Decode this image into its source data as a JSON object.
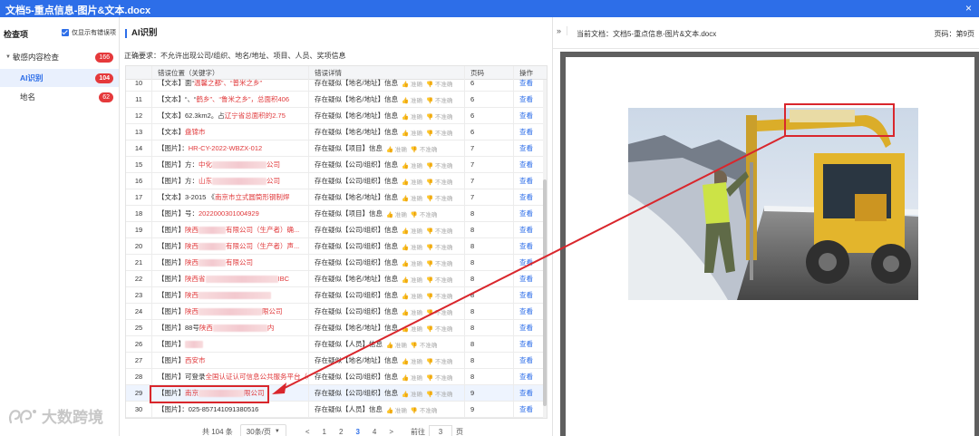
{
  "titlebar": {
    "title": "文档5-重点信息-图片&文本.docx",
    "close": "×"
  },
  "sidebar": {
    "heading": "检查项",
    "only_errors": "仅显示有错误项",
    "items": [
      {
        "label": "敏感内容检查",
        "count": "166"
      },
      {
        "label": "AI识别",
        "count": "104"
      },
      {
        "label": "地名",
        "count": "62"
      }
    ]
  },
  "watermark": "大数跨境",
  "main": {
    "title": "AI识别",
    "requirement": "正确要求：不允许出现公司/组织、地名/地址、项目、人员、奖项信息",
    "columns": [
      "",
      "错误位置（关键字）",
      "错误详情",
      "页码",
      "操作"
    ],
    "accurate_label": "准确",
    "inaccurate_label": "不准确",
    "view_label": "查看",
    "rows": [
      {
        "no": "10",
        "pre": "【文本】面“",
        "red": "温馨之都",
        "post": "”、“普米之乡”",
        "detail": "存在疑似【地名/地址】信息",
        "page": "6"
      },
      {
        "no": "11",
        "pre": "【文本】“、“",
        "red": "鹤乡",
        "post": "”、“鲁米之乡”，总面积406",
        "detail": "存在疑似【地名/地址】信息",
        "page": "6"
      },
      {
        "no": "12",
        "pre": "【文本】62.3km2。占",
        "red": "辽宁省",
        "post": "总面积的2.75",
        "detail": "存在疑似【地名/地址】信息",
        "page": "6"
      },
      {
        "no": "13",
        "pre": "【文本】",
        "red": "盘锦市",
        "post": "",
        "detail": "存在疑似【地名/地址】信息",
        "page": "6"
      },
      {
        "no": "14",
        "pre": "【图片】：",
        "red": "HR-CY-2022-WBZX-012",
        "post": "",
        "detail": "存在疑似【项目】信息",
        "page": "7"
      },
      {
        "no": "15",
        "pre": "【图片】方：",
        "red": "中化",
        "post": "公司",
        "detail": "存在疑似【公司/组织】信息",
        "page": "7",
        "blur": 60
      },
      {
        "no": "16",
        "pre": "【图片】方：",
        "red": "山东",
        "post": "公司",
        "detail": "存在疑似【公司/组织】信息",
        "page": "7",
        "blur": 60
      },
      {
        "no": "17",
        "pre": "【文本】3-2015 《",
        "red": "南京市",
        "post": "立式圆筒形钢制焊",
        "detail": "存在疑似【地名/地址】信息",
        "page": "7"
      },
      {
        "no": "18",
        "pre": "【图片】号：",
        "red": "2022000301004929",
        "post": "",
        "detail": "存在疑似【项目】信息",
        "page": "8"
      },
      {
        "no": "19",
        "pre": "【图片】",
        "red": "陕西",
        "post": "有限公司（生产者）确...",
        "detail": "存在疑似【公司/组织】信息",
        "page": "8",
        "blur": 30
      },
      {
        "no": "20",
        "pre": "【图片】",
        "red": "陕西",
        "post": "有限公司（生产者）声...",
        "detail": "存在疑似【公司/组织】信息",
        "page": "8",
        "blur": 30
      },
      {
        "no": "21",
        "pre": "【图片】",
        "red": "陕西",
        "post": "有限公司",
        "detail": "存在疑似【公司/组织】信息",
        "page": "8",
        "blur": 30
      },
      {
        "no": "22",
        "pre": "【图片】",
        "red": "陕西省",
        "post": "IBC",
        "detail": "存在疑似【地名/地址】信息",
        "page": "8",
        "blur": 80
      },
      {
        "no": "23",
        "pre": "【图片】",
        "red": "陕西",
        "post": "",
        "detail": "存在疑似【公司/组织】信息",
        "page": "8",
        "blur": 80
      },
      {
        "no": "24",
        "pre": "【图片】",
        "red": "陕西",
        "post": "限公司",
        "detail": "存在疑似【公司/组织】信息",
        "page": "8",
        "blur": 70
      },
      {
        "no": "25",
        "pre": "【图片】88号",
        "red": "陕西",
        "post": "内",
        "detail": "存在疑似【地名/地址】信息",
        "page": "8",
        "blur": 60
      },
      {
        "no": "26",
        "pre": "【图片】",
        "red": "",
        "post": "",
        "detail": "存在疑似【人员】信息",
        "page": "8",
        "blur": 20
      },
      {
        "no": "27",
        "pre": "【图片】",
        "red": "西安市",
        "post": "",
        "detail": "存在疑似【地名/地址】信息",
        "page": "8"
      },
      {
        "no": "28",
        "pre": "【图片】可登录",
        "red": "全国认证认可信息公共服务平台",
        "post": "（cx",
        "detail": "存在疑似【公司/组织】信息",
        "page": "8"
      },
      {
        "no": "29",
        "pre": "【图片】",
        "red": "南京",
        "post": "限公司",
        "detail": "存在疑似【公司/组织】信息",
        "page": "9",
        "blur": 50,
        "selected": true
      },
      {
        "no": "30",
        "pre": "【图片】：025-857141091380516",
        "red": "",
        "post": "",
        "detail": "存在疑似【人员】信息",
        "page": "9"
      }
    ]
  },
  "pager": {
    "total": "共 104 条",
    "size": "30条/页",
    "prev": "<",
    "next": ">",
    "pages": [
      "1",
      "2",
      "3",
      "4"
    ],
    "current": "3",
    "goto_label": "前往",
    "goto_value": "3",
    "goto_suffix": "页"
  },
  "viewer": {
    "collapse": "»",
    "current_doc": "当前文档：文档5-重点信息-图片&文本.docx",
    "page_label": "页码：第9页"
  },
  "colors": {
    "accent": "#2d6ee8",
    "error": "#e0393b",
    "annotation": "#d9262c"
  }
}
